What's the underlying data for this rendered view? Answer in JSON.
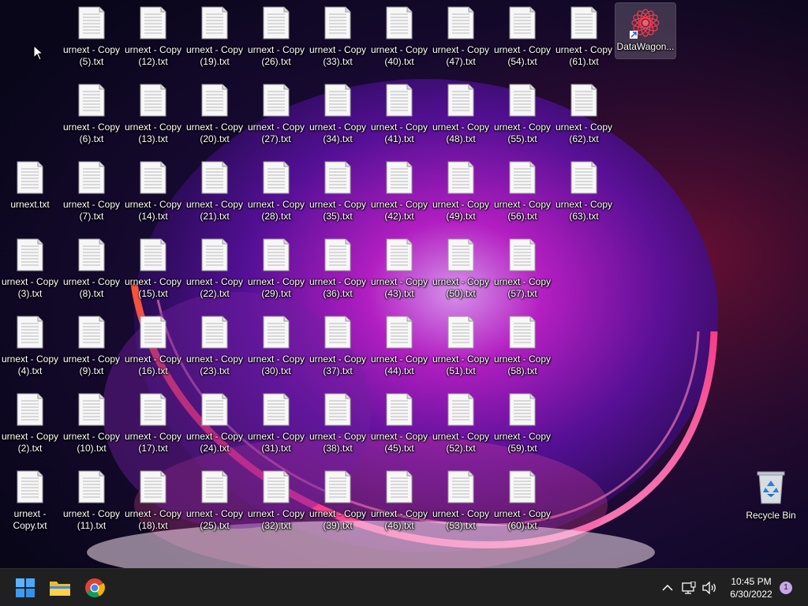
{
  "desktop": {
    "file_icon": "text-file-icon",
    "shortcut": {
      "label": "DataWagon...",
      "icon": "datawagon-app-icon",
      "selected": true
    },
    "recycle_bin": {
      "label": "Recycle Bin",
      "icon": "recycle-bin-icon"
    },
    "files": [
      "urnext - Copy (5).txt",
      "urnext - Copy (12).txt",
      "urnext - Copy (19).txt",
      "urnext - Copy (26).txt",
      "urnext - Copy (33).txt",
      "urnext - Copy (40).txt",
      "urnext - Copy (47).txt",
      "urnext - Copy (54).txt",
      "urnext - Copy (61).txt",
      "urnext - Copy (6).txt",
      "urnext - Copy (13).txt",
      "urnext - Copy (20).txt",
      "urnext - Copy (27).txt",
      "urnext - Copy (34).txt",
      "urnext - Copy (41).txt",
      "urnext - Copy (48).txt",
      "urnext - Copy (55).txt",
      "urnext - Copy (62).txt",
      "urnext.txt",
      "urnext - Copy (7).txt",
      "urnext - Copy (14).txt",
      "urnext - Copy (21).txt",
      "urnext - Copy (28).txt",
      "urnext - Copy (35).txt",
      "urnext - Copy (42).txt",
      "urnext - Copy (49).txt",
      "urnext - Copy (56).txt",
      "urnext - Copy (63).txt",
      "urnext - Copy (3).txt",
      "urnext - Copy (8).txt",
      "urnext - Copy (15).txt",
      "urnext - Copy (22).txt",
      "urnext - Copy (29).txt",
      "urnext - Copy (36).txt",
      "urnext - Copy (43).txt",
      "urnext - Copy (50).txt",
      "urnext - Copy (57).txt",
      "urnext - Copy (4).txt",
      "urnext - Copy (9).txt",
      "urnext - Copy (16).txt",
      "urnext - Copy (23).txt",
      "urnext - Copy (30).txt",
      "urnext - Copy (37).txt",
      "urnext - Copy (44).txt",
      "urnext - Copy (51).txt",
      "urnext - Copy (58).txt",
      "urnext - Copy (2).txt",
      "urnext - Copy (10).txt",
      "urnext - Copy (17).txt",
      "urnext - Copy (24).txt",
      "urnext - Copy (31).txt",
      "urnext - Copy (38).txt",
      "urnext - Copy (45).txt",
      "urnext - Copy (52).txt",
      "urnext - Copy (59).txt",
      "urnext - Copy.txt",
      "urnext - Copy (11).txt",
      "urnext - Copy (18).txt",
      "urnext - Copy (25).txt",
      "urnext - Copy (32).txt",
      "urnext - Copy (39).txt",
      "urnext - Copy (46).txt",
      "urnext - Copy (53).txt",
      "urnext - Copy (60).txt"
    ]
  },
  "taskbar": {
    "pinned": [
      {
        "name": "start",
        "icon": "windows-start-icon"
      },
      {
        "name": "file-explorer",
        "icon": "folder-icon"
      },
      {
        "name": "chrome",
        "icon": "chrome-icon"
      }
    ],
    "tray": {
      "overflow_icon": "chevron-up-icon",
      "network_icon": "network-icon",
      "volume_icon": "speaker-icon"
    },
    "clock": {
      "time": "10:45 PM",
      "date": "6/30/2022"
    },
    "notification_count": "1"
  },
  "colors": {
    "taskbar_bg": "#202020",
    "accent_pink": "#ff2a7a",
    "accent_purple": "#b02ad8"
  }
}
